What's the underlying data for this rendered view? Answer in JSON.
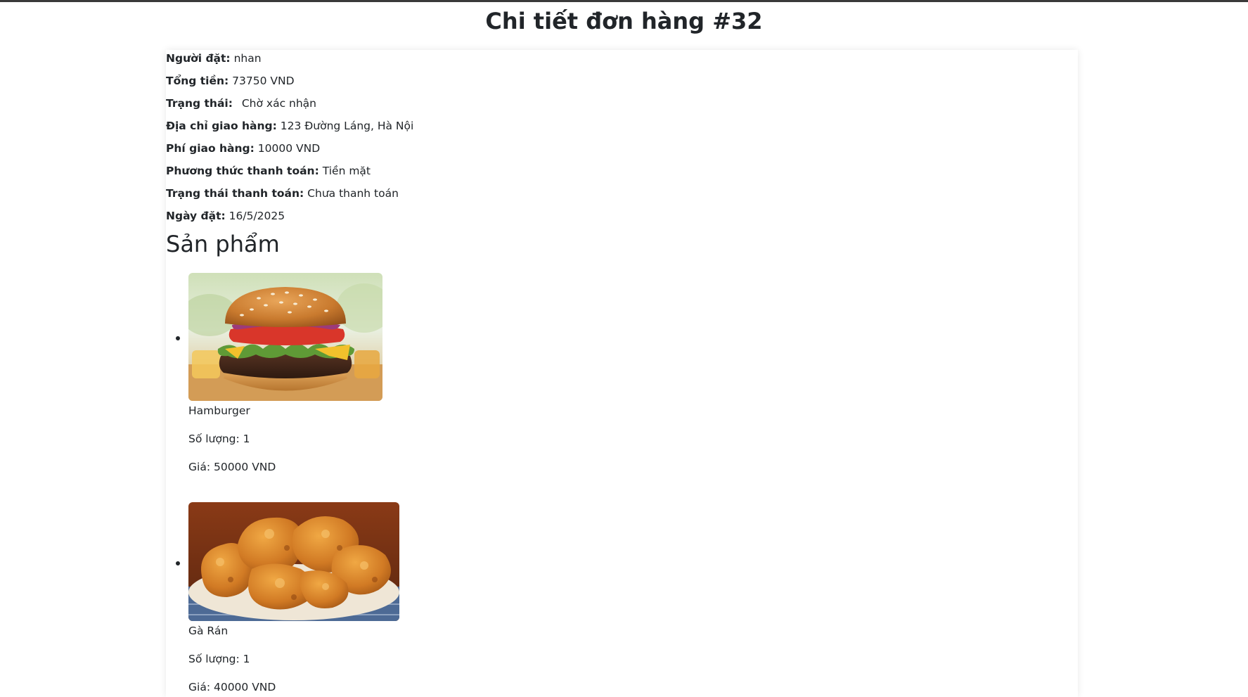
{
  "page": {
    "title": "Chi tiết đơn hàng #32"
  },
  "order": {
    "customer_label": "Người đặt:",
    "customer_value": "nhan",
    "total_label": "Tổng tiền:",
    "total_value": "73750 VND",
    "status_label": "Trạng thái:",
    "status_value": "Chờ xác nhận",
    "address_label": "Địa chỉ giao hàng:",
    "address_value": "123 Đường Láng, Hà Nội",
    "shipping_fee_label": "Phí giao hàng:",
    "shipping_fee_value": "10000 VND",
    "payment_method_label": "Phương thức thanh toán:",
    "payment_method_value": "Tiền mặt",
    "payment_status_label": "Trạng thái thanh toán:",
    "payment_status_value": "Chưa thanh toán",
    "date_label": "Ngày đặt:",
    "date_value": "16/5/2025"
  },
  "products_section": {
    "title": "Sản phẩm"
  },
  "products": [
    {
      "name": "Hamburger",
      "quantity": "Số lượng: 1",
      "price": "Giá: 50000 VND"
    },
    {
      "name": "Gà Rán",
      "quantity": "Số lượng: 1",
      "price": "Giá: 40000 VND"
    }
  ]
}
